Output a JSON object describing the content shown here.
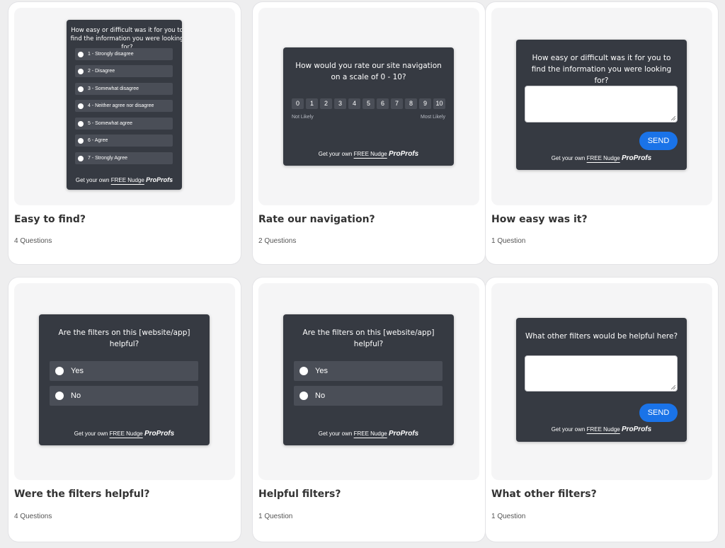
{
  "footer": {
    "prefix": "Get your own",
    "nudge": "FREE Nudge",
    "brand": "ProProfs"
  },
  "colors": {
    "widget_bg": "#363a42",
    "option_bg": "#4a4e57",
    "send_button": "#1a73e8",
    "page_bg": "#eeeeef"
  },
  "cards": [
    {
      "title": "Easy to find?",
      "count": "4 Questions",
      "question": "How easy or difficult was it for you to find the information you were looking for?",
      "options": [
        "1 - Strongly disagree",
        "2 - Disagree",
        "3 - Somewhat disagree",
        "4 - Neither agree nor disagree",
        "5 - Somewhat agree",
        "6 - Agree",
        "7 - Strongly Agree"
      ]
    },
    {
      "title": "Rate our navigation?",
      "count": "2 Questions",
      "question": "How would you rate our site navigation on a scale of 0 - 10?",
      "scale": [
        "0",
        "1",
        "2",
        "3",
        "4",
        "5",
        "6",
        "7",
        "8",
        "9",
        "10"
      ],
      "scale_low": "Not Likely",
      "scale_high": "Most Likely"
    },
    {
      "title": "How easy was it?",
      "count": "1 Question",
      "question": "How easy or difficult was it for you to find the information you were looking for?",
      "send": "SEND"
    },
    {
      "title": "Were the filters helpful?",
      "count": "4 Questions",
      "question": "Are the filters on this [website/app] helpful?",
      "options": [
        "Yes",
        "No"
      ]
    },
    {
      "title": "Helpful filters?",
      "count": "1 Question",
      "question": "Are the filters on this [website/app] helpful?",
      "options": [
        "Yes",
        "No"
      ]
    },
    {
      "title": "What other filters?",
      "count": "1 Question",
      "question": "What other filters would be helpful here?",
      "send": "SEND"
    }
  ]
}
